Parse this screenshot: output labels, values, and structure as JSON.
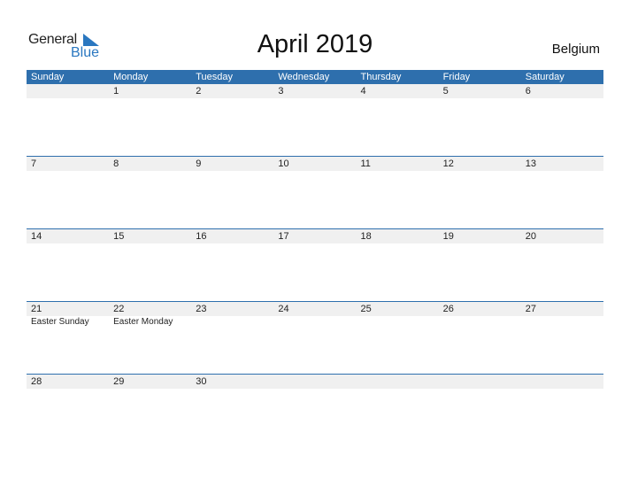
{
  "logo": {
    "general": "General",
    "blue": "Blue"
  },
  "title": "April 2019",
  "country": "Belgium",
  "colors": {
    "header": "#2e6fad",
    "strip": "#f0f0f0",
    "logo_blue": "#2a77c0"
  },
  "days": [
    "Sunday",
    "Monday",
    "Tuesday",
    "Wednesday",
    "Thursday",
    "Friday",
    "Saturday"
  ],
  "weeks": [
    {
      "dates": [
        "",
        "1",
        "2",
        "3",
        "4",
        "5",
        "6"
      ],
      "events": [
        "",
        "",
        "",
        "",
        "",
        "",
        ""
      ]
    },
    {
      "dates": [
        "7",
        "8",
        "9",
        "10",
        "11",
        "12",
        "13"
      ],
      "events": [
        "",
        "",
        "",
        "",
        "",
        "",
        ""
      ]
    },
    {
      "dates": [
        "14",
        "15",
        "16",
        "17",
        "18",
        "19",
        "20"
      ],
      "events": [
        "",
        "",
        "",
        "",
        "",
        "",
        ""
      ]
    },
    {
      "dates": [
        "21",
        "22",
        "23",
        "24",
        "25",
        "26",
        "27"
      ],
      "events": [
        "Easter Sunday",
        "Easter Monday",
        "",
        "",
        "",
        "",
        ""
      ]
    },
    {
      "dates": [
        "28",
        "29",
        "30",
        "",
        "",
        "",
        ""
      ],
      "events": [
        "",
        "",
        "",
        "",
        "",
        "",
        ""
      ]
    }
  ]
}
